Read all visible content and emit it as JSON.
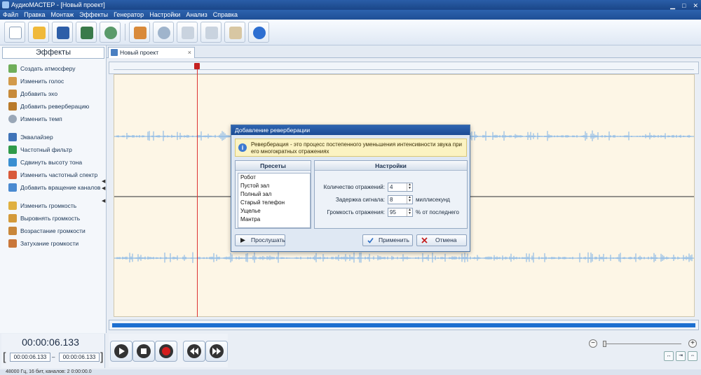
{
  "window": {
    "title": "АудиоМАСТЕР - [Новый проект]"
  },
  "menu": [
    "Файл",
    "Правка",
    "Монтаж",
    "Эффекты",
    "Генератор",
    "Настройки",
    "Анализ",
    "Справка"
  ],
  "toolbar": {
    "icons": [
      "new-file-icon",
      "open-folder-icon",
      "save-icon",
      "export-icon",
      "record-disc-icon",
      "effects-icon",
      "undo-icon",
      "cut-icon",
      "copy-icon",
      "paste-icon",
      "help-icon"
    ]
  },
  "effects_panel": {
    "title": "Эффекты",
    "items": [
      "Создать атмосферу",
      "Изменить голос",
      "Добавить эхо",
      "Добавить реверберацию",
      "Изменить темп",
      "Эквалайзер",
      "Частотный фильтр",
      "Сдвинуть высоту тона",
      "Изменить частотный спектр",
      "Добавить вращение каналов",
      "Изменить громкость",
      "Выровнять громкость",
      "Возрастание громкости",
      "Затухание громкости"
    ]
  },
  "tab": {
    "label": "Новый проект",
    "close": "×"
  },
  "playback": {
    "current_time": "00:00:06.133",
    "sel_start": "00:00:06.133",
    "sel_sep": "–",
    "sel_end": "00:00:06.133"
  },
  "status": {
    "text": "48000 Гц, 16 бит, каналов: 2   0:00:00.0"
  },
  "dialog": {
    "title": "Добавление реверберации",
    "info": "Реверберация - это процесс постепенного уменьшения интенсивности звука при его многократных отражениях",
    "presets_header": "Пресеты",
    "presets": [
      "Робот",
      "Пустой зал",
      "Полный зал",
      "Старый телефон",
      "Ущелье",
      "Мантра"
    ],
    "settings_header": "Настройки",
    "settings": [
      {
        "label": "Количество отражений:",
        "value": "4",
        "unit": ""
      },
      {
        "label": "Задержка сигнала:",
        "value": "8",
        "unit": "миллисекунд"
      },
      {
        "label": "Громкость отражения:",
        "value": "95",
        "unit": "% от последнего"
      }
    ],
    "listen_label": "Прослушать",
    "apply_label": "Применить",
    "cancel_label": "Отмена"
  },
  "zoom": {
    "minus": "−",
    "plus": "+"
  },
  "colors": {
    "accent": "#1c6fd0",
    "waveform": "#7bb0e6",
    "cursor": "#d33333",
    "title": "#1c4c94"
  }
}
